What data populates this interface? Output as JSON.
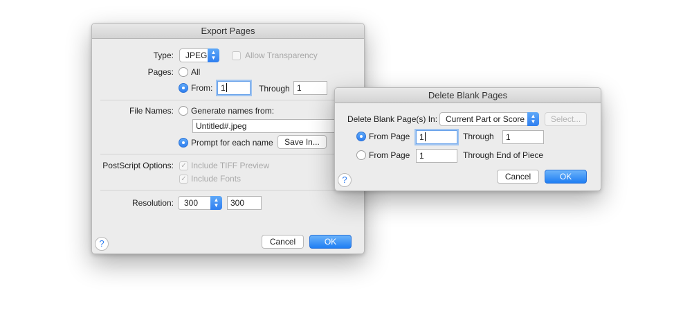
{
  "export_dialog": {
    "title": "Export Pages",
    "type_label": "Type:",
    "type_value": "JPEG",
    "allow_transparency_label": "Allow Transparency",
    "pages_label": "Pages:",
    "all_label": "All",
    "from_label": "From:",
    "from_value": "1",
    "through_label": "Through",
    "through_value": "1",
    "file_names_label": "File Names:",
    "generate_names_label": "Generate names from:",
    "generate_names_value": "Untitled#.jpeg",
    "prompt_label": "Prompt for each name",
    "save_in_label": "Save In...",
    "postscript_label": "PostScript Options:",
    "include_tiff_label": "Include TIFF Preview",
    "include_fonts_label": "Include Fonts",
    "resolution_label": "Resolution:",
    "resolution_value": "300",
    "resolution_field_value": "300",
    "help_label": "?",
    "cancel_label": "Cancel",
    "ok_label": "OK"
  },
  "delete_dialog": {
    "title": "Delete Blank Pages",
    "in_label": "Delete Blank Page(s) In:",
    "in_value": "Current Part or Score",
    "select_label": "Select...",
    "from_page_label_1": "From Page",
    "from_page_value_1": "1",
    "through_label": "Through",
    "through_value": "1",
    "from_page_label_2": "From Page",
    "from_page_value_2": "1",
    "through_end_label": "Through End of Piece",
    "help_label": "?",
    "cancel_label": "Cancel",
    "ok_label": "OK"
  },
  "icons": {
    "popup_arrows": "◆",
    "checkmark": "✓"
  },
  "colors": {
    "accent": "#2f7ff0",
    "dialog_bg": "#ececec"
  }
}
